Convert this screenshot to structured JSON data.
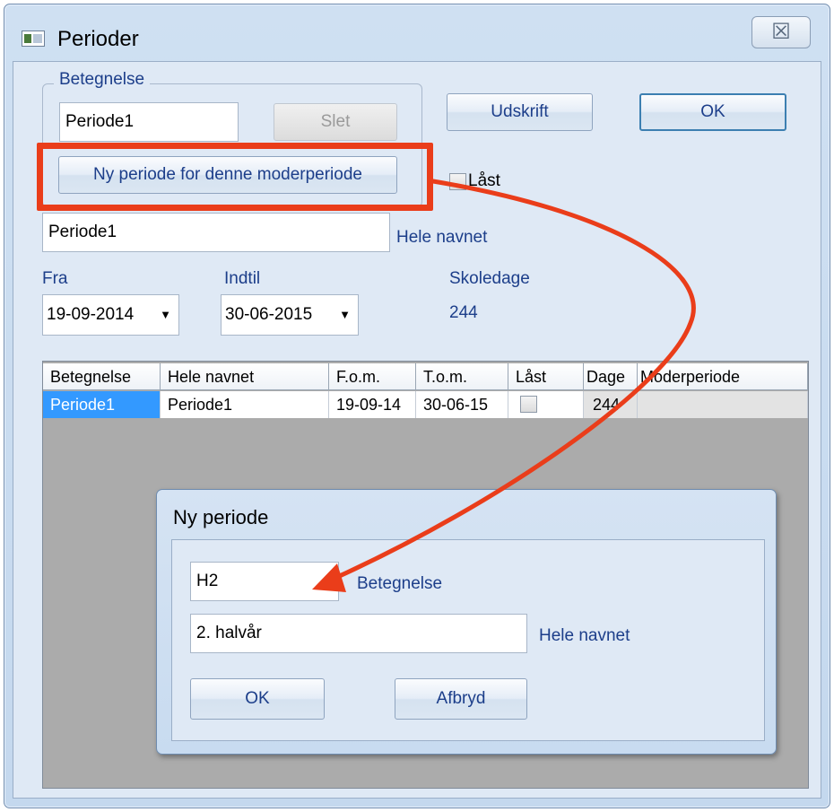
{
  "window": {
    "title": "Perioder",
    "close_glyph": "☒"
  },
  "group": {
    "label": "Betegnelse",
    "short_name_value": "Periode1",
    "delete_button": "Slet",
    "new_period_button": "Ny periode for denne moderperiode"
  },
  "toolbar": {
    "print_button": "Udskrift",
    "ok_button": "OK"
  },
  "locked": {
    "label": "Låst",
    "checked": false
  },
  "full_name": {
    "value": "Periode1",
    "label": "Hele navnet"
  },
  "dates": {
    "from_label": "Fra",
    "from_value": "19-09-2014",
    "to_label": "Indtil",
    "to_value": "30-06-2015",
    "schooldays_label": "Skoledage",
    "schooldays_value": "244"
  },
  "grid": {
    "columns": [
      "Betegnelse",
      "Hele navnet",
      "F.o.m.",
      "T.o.m.",
      "Låst",
      "Dage",
      "Moderperiode"
    ],
    "rows": [
      {
        "betegnelse": "Periode1",
        "hele_navnet": "Periode1",
        "fom": "19-09-14",
        "tom": "30-06-15",
        "laast": false,
        "dage": "244",
        "moderperiode": ""
      }
    ]
  },
  "dialog": {
    "title": "Ny periode",
    "short_name_value": "H2",
    "short_name_label": "Betegnelse",
    "full_name_value": "2. halvår",
    "full_name_label": "Hele navnet",
    "ok_button": "OK",
    "cancel_button": "Afbryd"
  },
  "colors": {
    "highlight": "#ea3d1a",
    "label_text": "#1c3e8a",
    "selected_row": "#3399ff"
  }
}
